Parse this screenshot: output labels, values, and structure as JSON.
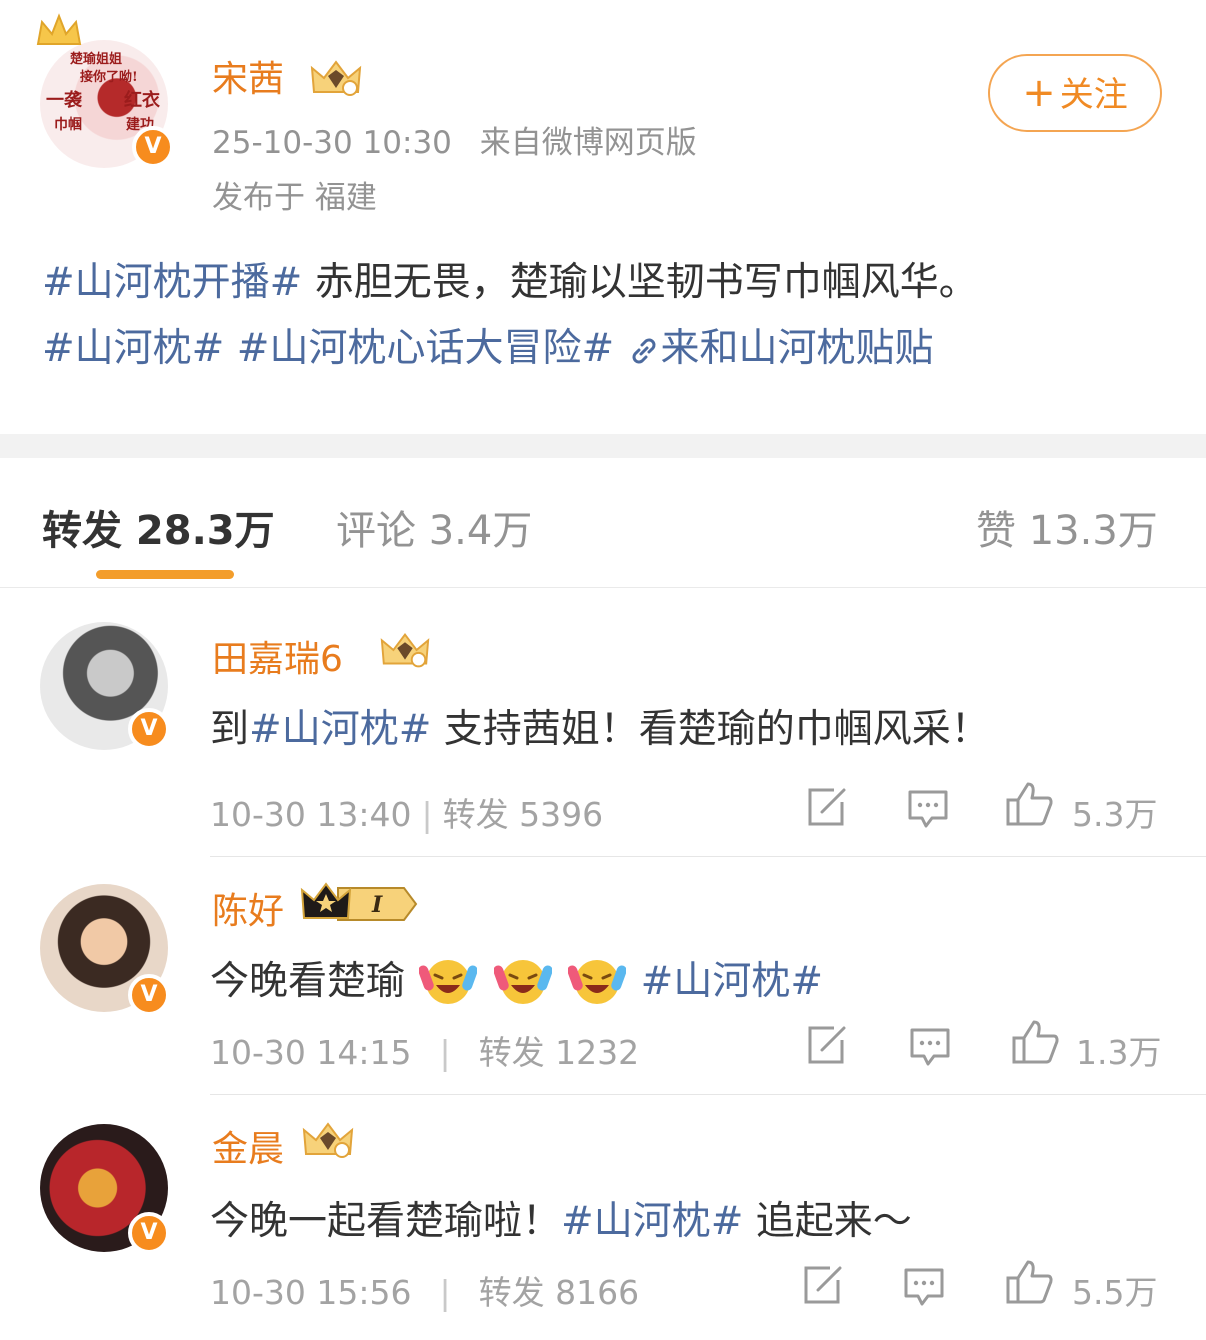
{
  "post": {
    "author": "宋茜",
    "avatar_text": [
      "楚瑜姐姐",
      "接你了呦!",
      "一袭",
      "红衣",
      "巾帼",
      "建功"
    ],
    "verified_badge": "V",
    "time": "25-10-30 10:30",
    "source": "来自微博网页版",
    "location": "发布于 福建",
    "follow_label": "关注",
    "content": {
      "tag1": "#山河枕开播#",
      "text1": " 赤胆无畏，楚瑜以坚韧书写巾帼风华。",
      "tag2": "#山河枕#",
      "tag3": "#山河枕心话大冒险#",
      "link_text": "来和山河枕贴贴"
    }
  },
  "tabs": {
    "repost": "转发 28.3万",
    "comment": "评论 3.4万",
    "like": "赞 13.3万"
  },
  "reposts": [
    {
      "author": "田嘉瑞6",
      "text_before": "到",
      "tag": "#山河枕#",
      "text_after": " 支持茜姐！看楚瑜的巾帼风采！",
      "time": "10-30 13:40",
      "separator": "|",
      "repost_count": "转发 5396",
      "likes": "5.3万"
    },
    {
      "author": "陈好",
      "text_before": "今晚看楚瑜",
      "tag": "#山河枕#",
      "time": "10-30 14:15",
      "separator": "|",
      "repost_count": "转发 1232",
      "likes": "1.3万",
      "rank_level": "I"
    },
    {
      "author": "金晨",
      "text_before": "今晚一起看楚瑜啦！",
      "tag": "#山河枕#",
      "text_after": " 追起来～",
      "time": "10-30 15:56",
      "separator": "|",
      "repost_count": "转发 8166",
      "likes": "5.5万"
    }
  ],
  "colors": {
    "username": "#e87c1e",
    "tag": "#4c6a9e",
    "accent": "#f39d2b",
    "verified": "#f78c1e"
  }
}
